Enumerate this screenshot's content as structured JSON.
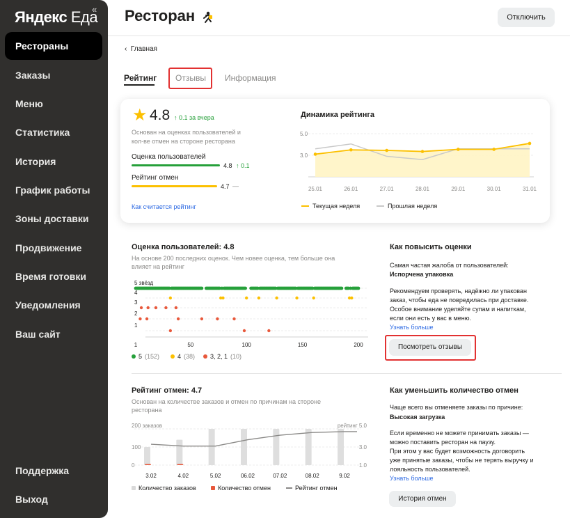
{
  "app": {
    "logo_bold": "Яндекс",
    "logo_regular": " Еда",
    "collapse_icon": "«"
  },
  "sidebar": {
    "items": [
      "Рестораны",
      "Заказы",
      "Меню",
      "Статистика",
      "История",
      "График работы",
      "Зоны доставки",
      "Продвижение",
      "Время готовки",
      "Уведомления",
      "Ваш сайт"
    ],
    "support": "Поддержка",
    "logout": "Выход"
  },
  "header": {
    "title": "Ресторан",
    "off_button": "Отключить"
  },
  "breadcrumb": {
    "arrow": "‹",
    "label": "Главная"
  },
  "tabs": [
    "Рейтинг",
    "Отзывы",
    "Информация"
  ],
  "rating_card": {
    "star": "★",
    "value": "4.8",
    "delta": "↑ 0.1 за вчера",
    "desc1": "Основан на оценках пользователей и",
    "desc2": "кол-ве отмен на стороне ресторана",
    "users_label": "Оценка пользователей",
    "users_value": "4.8",
    "users_delta": "↑ 0.1",
    "cancel_label": "Рейтинг отмен",
    "cancel_value": "4.7",
    "cancel_delta": "—",
    "how_link": "Как считается рейтинг"
  },
  "dynamics": {
    "title": "Динамика рейтинга",
    "yticks": [
      "5.0",
      "3.0"
    ],
    "xticks": [
      "25.01",
      "26.01",
      "27.01",
      "28.01",
      "29.01",
      "30.01",
      "31.01"
    ],
    "legend_current": "Текущая неделя",
    "legend_prev": "Прошлая неделя"
  },
  "user_ratings": {
    "title": "Оценка пользователей: 4.8",
    "desc1": "На основе 200 последних оценок. Чем новее оценка, тем больше она",
    "desc2": "влияет на рейтинг",
    "yticks": [
      "5 звёзд",
      "4",
      "3",
      "2",
      "1"
    ],
    "xticks": [
      "1",
      "50",
      "100",
      "150",
      "200"
    ],
    "legend": [
      {
        "label": "5",
        "count": "(152)"
      },
      {
        "label": "4",
        "count": "(38)"
      },
      {
        "label": "3, 2, 1",
        "count": "(10)"
      }
    ]
  },
  "improve": {
    "title": "Как повысить оценки",
    "l1": "Самая частая жалоба от пользователей:",
    "l2": "Испорчена упаковка",
    "l3": "Рекомендуем проверять, надёжно ли упакован",
    "l4": "заказ, чтобы еда не повредилась при доставке.",
    "l5": "Особое внимание уделяйте супам и напиткам,",
    "l6": "если они есть у вас в меню.",
    "link": "Узнать больше",
    "button": "Посмотреть отзывы"
  },
  "cancel_rating": {
    "title": "Рейтинг отмен: 4.7",
    "desc1": "Основан на количестве заказов и отмен по причинам на стороне",
    "desc2": "ресторана",
    "left_top": "200 заказов",
    "right_top": "рейтинг 5.0",
    "left_ticks": [
      "100",
      "0"
    ],
    "right_ticks": [
      "3.0",
      "1.0"
    ],
    "xticks": [
      "3.02",
      "4.02",
      "5.02",
      "06.02",
      "07.02",
      "08.02",
      "9.02"
    ],
    "legend_orders": "Количество заказов",
    "legend_cancels": "Количество отмен",
    "legend_rating": "Рейтинг отмен"
  },
  "reduce": {
    "title": "Как уменьшить количество отмен",
    "l1": "Чаще всего вы отменяете заказы по причине:",
    "l2": "Высокая загрузка",
    "l3": "Если временно не можете принимать заказы —",
    "l4": "можно поставить ресторан на паузу.",
    "l5": "При этом у вас будет возможность договорить",
    "l6": "уже принятые заказы, чтобы не терять выручку и",
    "l7": "лояльность пользователей.",
    "link": "Узнать больше",
    "button": "История отмен"
  },
  "colors": {
    "accent_yellow": "#fcc000",
    "green": "#26a03a",
    "red": "#e8583b",
    "link": "#2d6ae3",
    "highlight": "#e23131"
  },
  "chart_data": [
    {
      "type": "line",
      "x": [
        "25.01",
        "26.01",
        "27.01",
        "28.01",
        "29.01",
        "30.01",
        "31.01"
      ],
      "series": [
        {
          "name": "Текущая неделя",
          "values": [
            3.1,
            3.5,
            3.45,
            3.35,
            3.55,
            3.55,
            4.1
          ]
        },
        {
          "name": "Прошлая неделя",
          "values": [
            3.6,
            4.05,
            2.9,
            2.6,
            3.6,
            3.6,
            3.6
          ]
        }
      ],
      "ylim": [
        1,
        5
      ]
    },
    {
      "type": "bar",
      "x": [
        "3.02",
        "4.02",
        "5.02",
        "06.02",
        "07.02",
        "08.02",
        "9.02"
      ],
      "series": [
        {
          "name": "Количество заказов",
          "values": [
            100,
            140,
            200,
            200,
            200,
            200,
            200
          ]
        },
        {
          "name": "Количество отмен",
          "values": [
            6,
            6,
            0,
            0,
            0,
            0,
            0
          ]
        },
        {
          "name": "Рейтинг отмен",
          "values": [
            3.3,
            3.1,
            3.1,
            3.8,
            4.3,
            4.6,
            4.7
          ]
        }
      ],
      "ylim": [
        0,
        200
      ]
    }
  ]
}
